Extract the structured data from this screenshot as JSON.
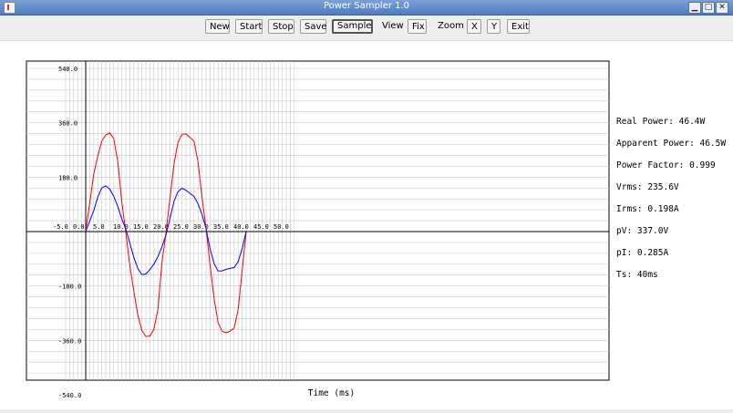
{
  "window": {
    "title": "Power Sampler 1.0",
    "controls": [
      "▁",
      "□",
      "✕"
    ]
  },
  "toolbar": {
    "new_label": "New",
    "start_label": "Start",
    "stop_label": "Stop",
    "save_label": "Save",
    "sample_label": "Sample",
    "view_label": "View",
    "fix_label": "Fix",
    "zoom_label": "Zoom",
    "zoom_x_label": "X",
    "zoom_y_label": "Y",
    "exit_label": "Exit"
  },
  "readouts": {
    "real_power": "Real Power: 46.4W",
    "apparent_power": "Apparent Power: 46.5W",
    "power_factor": "Power Factor: 0.999",
    "vrms": "Vrms: 235.6V",
    "irms": "Irms: 0.198A",
    "pv": "pV: 337.0V",
    "pi": "pI: 0.285A",
    "ts": "Ts: 40ms"
  },
  "chart_data": {
    "type": "line",
    "xlabel": "Time (ms)",
    "ylabel": "",
    "xlim": [
      -5,
      52
    ],
    "ylim": [
      -540,
      540
    ],
    "x_ticks": [
      "-5.0",
      "0.0",
      "5.0",
      "10.0",
      "15.0",
      "20.0",
      "25.0",
      "30.0",
      "35.0",
      "40.0",
      "45.0",
      "50.0"
    ],
    "y_ticks": [
      "540.0",
      "360.0",
      "180.0",
      "0.0",
      "-180.0",
      "-360.0",
      "-540.0"
    ],
    "grid": true,
    "series": [
      {
        "color": "#ff0000",
        "x": [
          0,
          2,
          3,
          4,
          5,
          6,
          7,
          8,
          9,
          10,
          11,
          12,
          13,
          14,
          15,
          16,
          17,
          18,
          19,
          20,
          21,
          22,
          23,
          24,
          25,
          26,
          27,
          28,
          29,
          30,
          31,
          32,
          33,
          34,
          35,
          36,
          37,
          38,
          39,
          40
        ],
        "y": [
          0,
          200,
          260,
          300,
          310,
          315,
          305,
          240,
          110,
          0,
          -120,
          -210,
          -280,
          -320,
          -335,
          -340,
          -330,
          -270,
          -110,
          0,
          120,
          230,
          290,
          310,
          315,
          315,
          310,
          240,
          110,
          0,
          -120,
          -220,
          -290,
          -320,
          -335,
          -340,
          -330,
          -260,
          -120,
          0
        ]
      },
      {
        "color": "#0000ff",
        "x": [
          0,
          2,
          3,
          4,
          5,
          6,
          7,
          8,
          9,
          10,
          11,
          12,
          13,
          14,
          15,
          16,
          17,
          18,
          19,
          20,
          21,
          22,
          23,
          24,
          25,
          26,
          27,
          28,
          29,
          30,
          31,
          32,
          33,
          34,
          35,
          36,
          37,
          38,
          39,
          40
        ],
        "y": [
          0,
          80,
          115,
          135,
          140,
          138,
          125,
          95,
          45,
          0,
          -50,
          -90,
          -115,
          -130,
          -135,
          -132,
          -120,
          -90,
          -45,
          0,
          50,
          95,
          120,
          135,
          140,
          138,
          125,
          90,
          45,
          0,
          -55,
          -95,
          -120,
          -130,
          -135,
          -133,
          -120,
          -90,
          -45,
          0
        ]
      }
    ]
  }
}
